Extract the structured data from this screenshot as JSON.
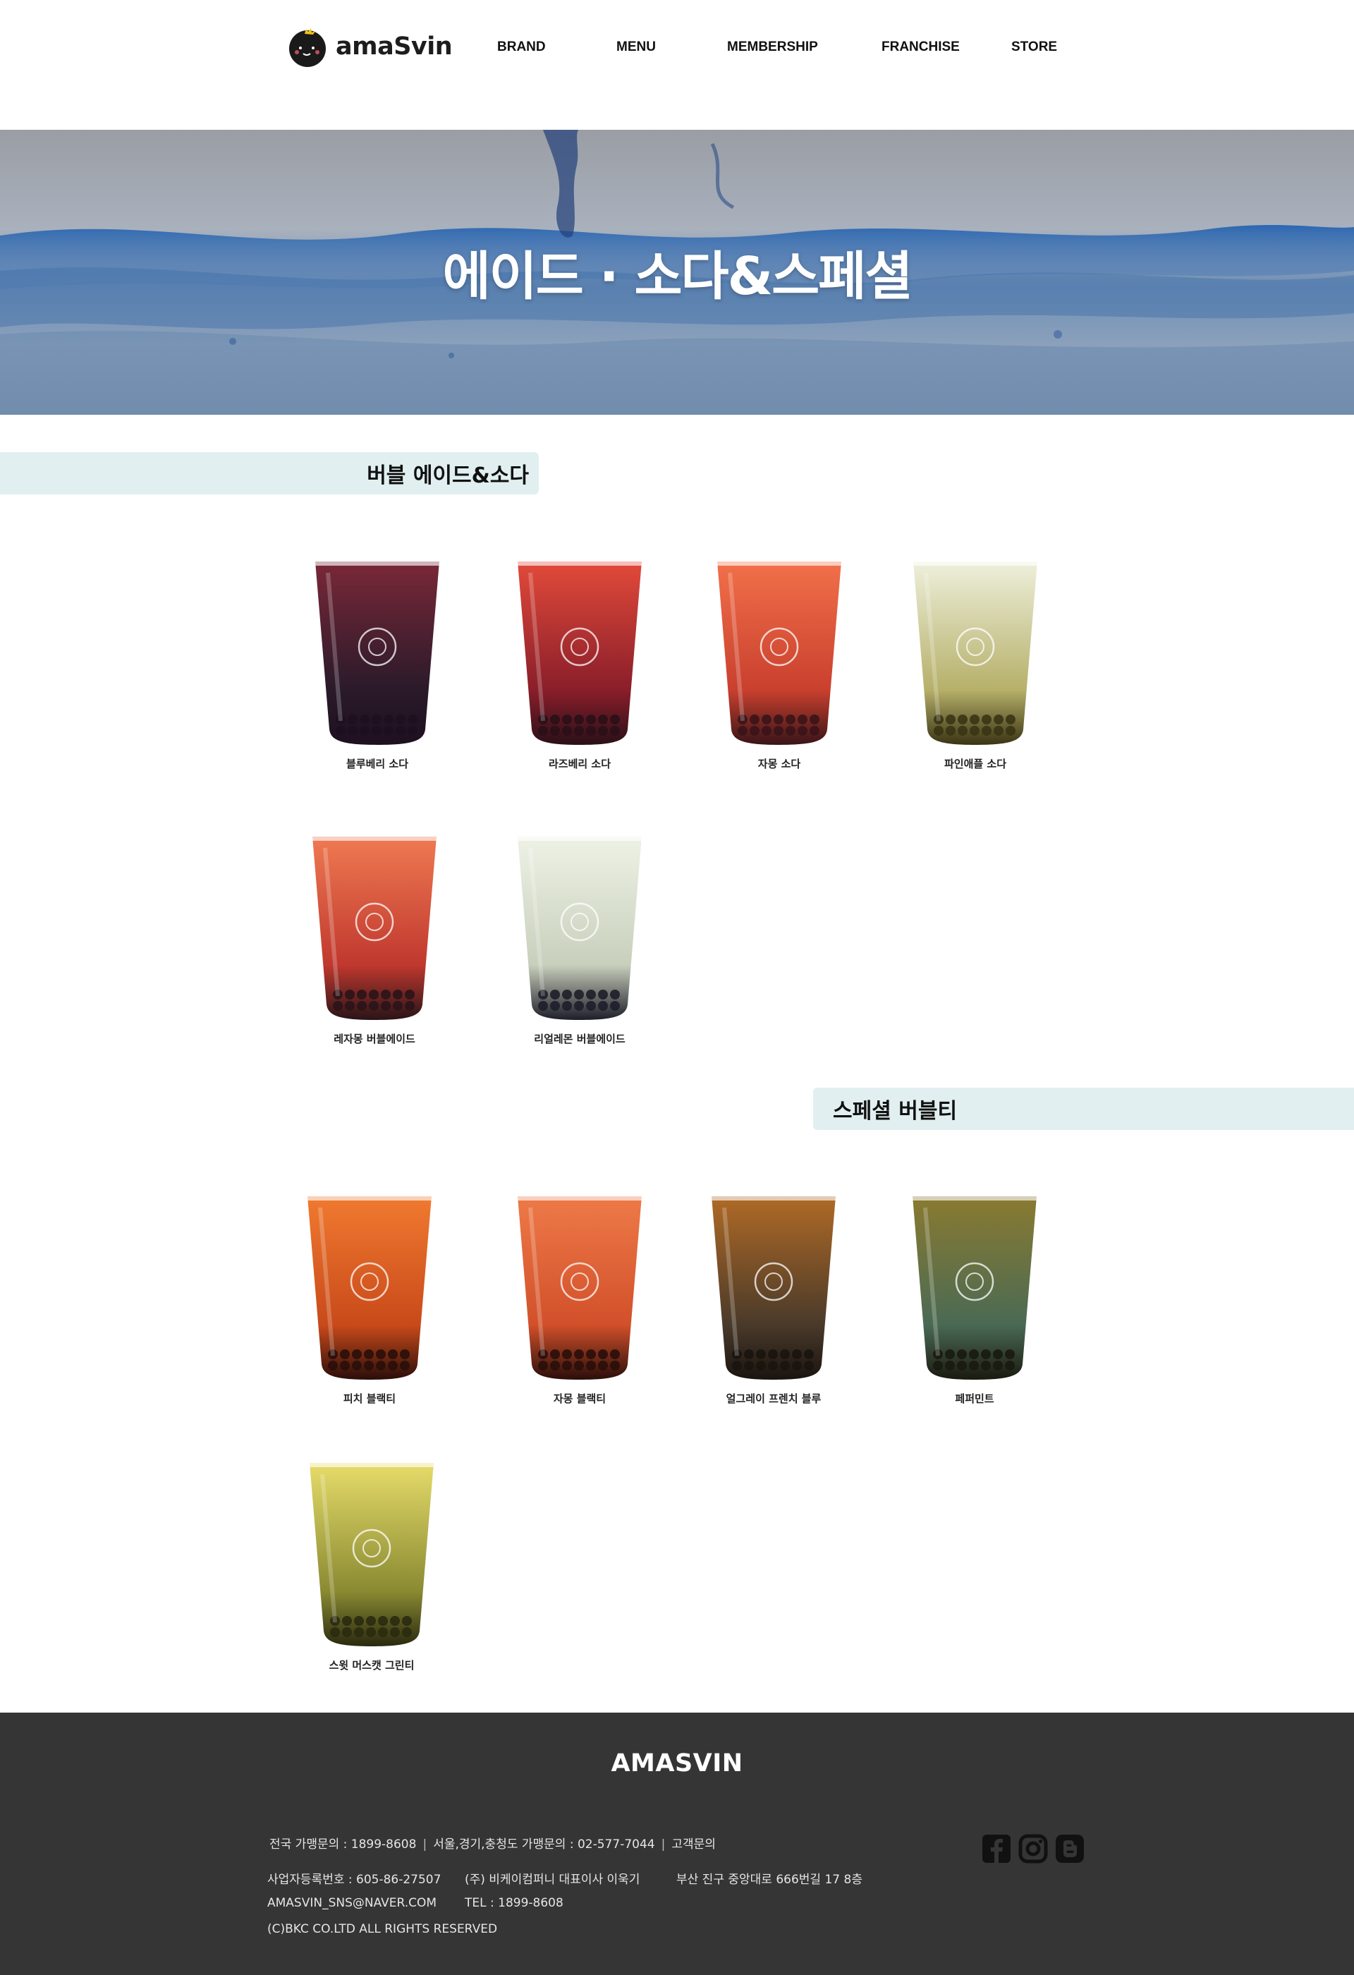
{
  "header": {
    "logo_text": "amaSvin",
    "nav": [
      {
        "label": "BRAND"
      },
      {
        "label": "MENU"
      },
      {
        "label": "MEMBERSHIP"
      },
      {
        "label": "FRANCHISE"
      },
      {
        "label": "STORE"
      }
    ]
  },
  "hero": {
    "title": "에이드 · 소다&스페셜"
  },
  "sections": [
    {
      "title": "버블 에이드&소다",
      "products": [
        {
          "name": "블루베리 소다",
          "color_top": "#7a2838",
          "color_bottom": "#2a1a2a",
          "bubble": "#1e1020"
        },
        {
          "name": "라즈베리 소다",
          "color_top": "#e24a3a",
          "color_bottom": "#8a1e2a",
          "bubble": "#2a1018"
        },
        {
          "name": "자몽 소다",
          "color_top": "#f2704a",
          "color_bottom": "#c9402e",
          "bubble": "#3a1418"
        },
        {
          "name": "파인애플 소다",
          "color_top": "#eef0dc",
          "color_bottom": "#b6b06a",
          "bubble": "#3a3414"
        },
        {
          "name": "레자몽 버블에이드",
          "color_top": "#ef7a52",
          "color_bottom": "#c0382e",
          "bubble": "#2a1418"
        },
        {
          "name": "리얼레몬 버블에이드",
          "color_top": "#eef2e6",
          "color_bottom": "#c8d0bc",
          "bubble": "#1e1e2a"
        }
      ]
    },
    {
      "title": "스페셜 버블티",
      "products": [
        {
          "name": "피치 블랙티",
          "color_top": "#f07a30",
          "color_bottom": "#c94a1a",
          "bubble": "#2a0e0a"
        },
        {
          "name": "자몽 블랙티",
          "color_top": "#ee7a48",
          "color_bottom": "#d2502a",
          "bubble": "#2a0e0a"
        },
        {
          "name": "얼그레이 프렌치 블루",
          "color_top": "#b06a26",
          "color_bottom": "#4a3a2a",
          "bubble": "#1a1410"
        },
        {
          "name": "페퍼민트",
          "color_top": "#8a7a30",
          "color_bottom": "#4a6a54",
          "bubble": "#1a1a10"
        },
        {
          "name": "스윗 머스캣 그린티",
          "color_top": "#e6dc6a",
          "color_bottom": "#8a8a32",
          "bubble": "#2a2a10"
        }
      ]
    }
  ],
  "footer": {
    "brand": "AMASVIN",
    "line1": [
      "전국 가맹문의 : 1899-8608",
      "서울,경기,충청도 가맹문의 : 02-577-7044",
      "고객문의"
    ],
    "line1_sep": "|",
    "line2": [
      "사업자등록번호 : 605-86-27507",
      "(주) 비케이컴퍼니 대표이사 이욱기",
      "부산 진구 중앙대로 666번길 17 8층"
    ],
    "line3": [
      "AMASVIN_SNS@NAVER.COM",
      "TEL : 1899-8608"
    ],
    "line4": "(C)BKC CO.LTD ALL RIGHTS RESERVED",
    "social": [
      {
        "icon": "facebook-icon"
      },
      {
        "icon": "instagram-icon"
      },
      {
        "icon": "blogger-icon"
      }
    ]
  }
}
